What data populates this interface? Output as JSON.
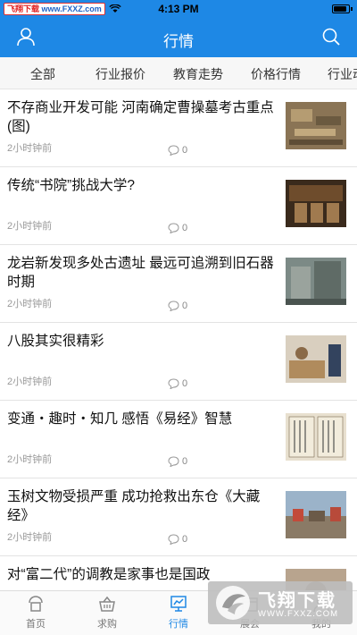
{
  "status_bar": {
    "time": "4:13 PM",
    "watermark_red": "飞翔下载",
    "watermark_blue": "www.FXXZ.com",
    "battery_level": 0.9
  },
  "nav": {
    "title": "行情"
  },
  "tabs": [
    {
      "label": "全部"
    },
    {
      "label": "行业报价"
    },
    {
      "label": "教育走势"
    },
    {
      "label": "价格行情"
    },
    {
      "label": "行业动"
    }
  ],
  "news": [
    {
      "title": "不存商业开发可能 河南确定曹操墓考古重点(图)",
      "time": "2小时钟前",
      "comments": "0"
    },
    {
      "title": "传统“书院”挑战大学?",
      "time": "2小时钟前",
      "comments": "0"
    },
    {
      "title": "龙岩新发现多处古遗址 最远可追溯到旧石器时期",
      "time": "2小时钟前",
      "comments": "0"
    },
    {
      "title": "八股其实很精彩",
      "time": "2小时钟前",
      "comments": "0"
    },
    {
      "title": "变通・趣时・知几 感悟《易经》智慧",
      "time": "2小时钟前",
      "comments": "0"
    },
    {
      "title": "玉树文物受损严重 成功抢救出东仓《大藏经》",
      "time": "2小时钟前",
      "comments": "0"
    },
    {
      "title": "对“富二代”的调教是家事也是国政",
      "time": "",
      "comments": ""
    }
  ],
  "tab_bar": [
    {
      "label": "首页",
      "icon": "home-icon"
    },
    {
      "label": "求购",
      "icon": "basket-icon"
    },
    {
      "label": "行情",
      "icon": "chart-icon"
    },
    {
      "label": "展会",
      "icon": "exhibition-icon"
    },
    {
      "label": "我的",
      "icon": "profile-icon"
    }
  ],
  "watermark_logo": {
    "title": "飞翔下载",
    "url": "WWW.FXXZ.COM"
  },
  "colors": {
    "primary": "#1e88e5",
    "tab_bg": "#f7f7f7",
    "active_tab": "#1e88e5"
  }
}
